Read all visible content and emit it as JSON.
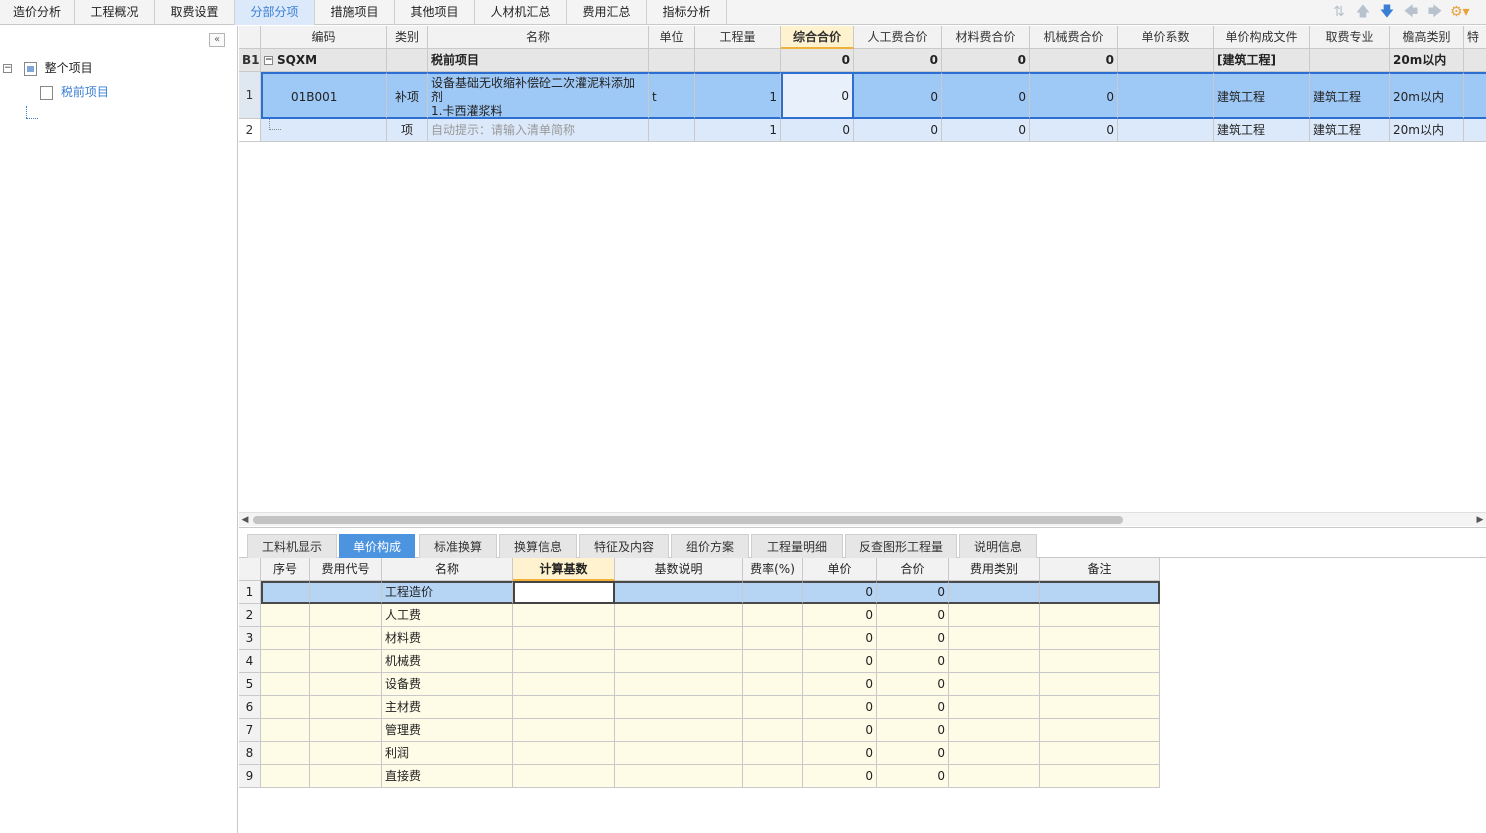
{
  "top_tabs": [
    {
      "label": "造价分析"
    },
    {
      "label": "工程概况"
    },
    {
      "label": "取费设置"
    },
    {
      "label": "分部分项"
    },
    {
      "label": "措施项目"
    },
    {
      "label": "其他项目"
    },
    {
      "label": "人材机汇总"
    },
    {
      "label": "费用汇总"
    },
    {
      "label": "指标分析"
    }
  ],
  "active_top_tab": "分部分项",
  "toolbar_icons": [
    "move-updown-icon",
    "arrow-up-icon",
    "arrow-down-icon",
    "arrow-left-icon",
    "arrow-right-icon",
    "settings-icon"
  ],
  "tree": {
    "root": {
      "label": "整个项目",
      "toggle": "⊟"
    },
    "child": {
      "label": "税前项目"
    }
  },
  "grid": {
    "headers": [
      "编码",
      "类别",
      "名称",
      "单位",
      "工程量",
      "综合合价",
      "人工费合价",
      "材料费合价",
      "机械费合价",
      "单价系数",
      "单价构成文件",
      "取费专业",
      "檐高类别",
      "特"
    ],
    "b1": {
      "rownum": "B1",
      "code": "SQXM",
      "name": "税前项目",
      "total": "0",
      "labor": "0",
      "material": "0",
      "machine": "0",
      "file": "[建筑工程]",
      "height": "20m以内"
    },
    "rows": [
      {
        "rownum": "1",
        "code": "01B001",
        "type": "补项",
        "name_line1": "设备基础无收缩补偿砼二次灌泥料添加",
        "name_line2": "剂",
        "name_line3": "1.卡西灌浆料",
        "unit": "t",
        "qty": "1",
        "total": "0",
        "labor": "0",
        "material": "0",
        "machine": "0",
        "file": "建筑工程",
        "specialty": "建筑工程",
        "height": "20m以内"
      },
      {
        "rownum": "2",
        "type": "项",
        "name_hint": "自动提示：请输入清单简称",
        "qty": "1",
        "total": "0",
        "labor": "0",
        "material": "0",
        "machine": "0",
        "file": "建筑工程",
        "specialty": "建筑工程",
        "height": "20m以内"
      }
    ]
  },
  "bottom_tabs": [
    {
      "label": "工料机显示"
    },
    {
      "label": "单价构成"
    },
    {
      "label": "标准换算"
    },
    {
      "label": "换算信息"
    },
    {
      "label": "特征及内容"
    },
    {
      "label": "组价方案"
    },
    {
      "label": "工程量明细"
    },
    {
      "label": "反查图形工程量"
    },
    {
      "label": "说明信息"
    }
  ],
  "active_bottom_tab": "单价构成",
  "bottom_grid": {
    "headers": [
      "序号",
      "费用代号",
      "名称",
      "计算基数",
      "基数说明",
      "费率(%)",
      "单价",
      "合价",
      "费用类别",
      "备注"
    ],
    "rows": [
      {
        "n": "1",
        "name": "工程造价",
        "price": "0",
        "total": "0"
      },
      {
        "n": "2",
        "name": "人工费",
        "price": "0",
        "total": "0"
      },
      {
        "n": "3",
        "name": "材料费",
        "price": "0",
        "total": "0"
      },
      {
        "n": "4",
        "name": "机械费",
        "price": "0",
        "total": "0"
      },
      {
        "n": "5",
        "name": "设备费",
        "price": "0",
        "total": "0"
      },
      {
        "n": "6",
        "name": "主材费",
        "price": "0",
        "total": "0"
      },
      {
        "n": "7",
        "name": "管理费",
        "price": "0",
        "total": "0"
      },
      {
        "n": "8",
        "name": "利润",
        "price": "0",
        "total": "0"
      },
      {
        "n": "9",
        "name": "直接费",
        "price": "0",
        "total": "0"
      }
    ]
  }
}
